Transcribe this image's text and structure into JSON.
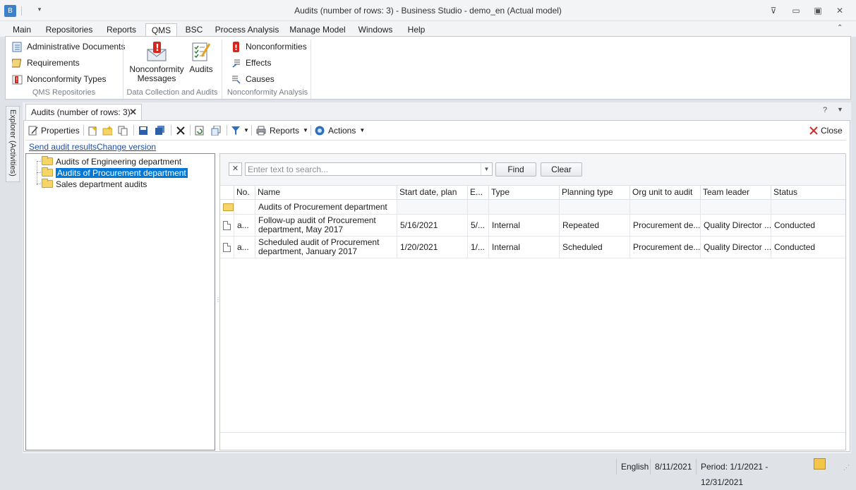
{
  "window": {
    "title": "Audits (number of rows: 3) - Business Studio - demo_en (Actual model)",
    "app_icon_text": "B"
  },
  "ribbon_tabs": [
    "Main",
    "Repositories",
    "Reports",
    "QMS",
    "BSC",
    "Process Analysis",
    "Manage Model",
    "Windows",
    "Help"
  ],
  "ribbon_active_tab": "QMS",
  "ribbon": {
    "qms_repositories": {
      "items": [
        "Administrative Documents",
        "Requirements",
        "Nonconformity Types"
      ],
      "label": "QMS Repositories"
    },
    "data_collection": {
      "nonconformity_messages": "Nonconformity Messages",
      "audits": "Audits",
      "label": "Data Collection and Audits"
    },
    "nonconformity_analysis": {
      "items": [
        "Nonconformities",
        "Effects",
        "Causes"
      ],
      "label": "Nonconformity Analysis"
    }
  },
  "explorer_tab": "Explorer (Activities)",
  "doc_tab": {
    "title": "Audits (number of rows: 3)",
    "close": "✕",
    "help": "?"
  },
  "toolbar": {
    "properties": "Properties",
    "reports": "Reports",
    "actions": "Actions",
    "close": "Close"
  },
  "links": {
    "send_audit_results": "Send audit results",
    "change_version": "Change version"
  },
  "tree": [
    {
      "label": "Audits of Engineering department",
      "selected": false
    },
    {
      "label": "Audits of Procurement department",
      "selected": true
    },
    {
      "label": "Sales department audits",
      "selected": false
    }
  ],
  "search": {
    "placeholder": "Enter text to search...",
    "find": "Find",
    "clear": "Clear"
  },
  "grid": {
    "columns": [
      "No.",
      "Name",
      "Start date, plan",
      "E...",
      "Type",
      "Planning type",
      "Org unit to audit",
      "Team leader",
      "Status"
    ],
    "group_row": "Audits of Procurement department",
    "rows": [
      {
        "no": "a...",
        "name": "Follow-up audit of Procurement department, May 2017",
        "start": "5/16/2021",
        "end": "5/...",
        "type": "Internal",
        "planning": "Repeated",
        "org": "Procurement de...",
        "leader": "Quality Director ...",
        "status": "Conducted"
      },
      {
        "no": "a...",
        "name": "Scheduled audit of Procurement department, January 2017",
        "start": "1/20/2021",
        "end": "1/...",
        "type": "Internal",
        "planning": "Scheduled",
        "org": "Procurement de...",
        "leader": "Quality Director ...",
        "status": "Conducted"
      }
    ]
  },
  "status_bar": {
    "language": "English",
    "date": "8/11/2021",
    "period": "Period: 1/1/2021 - 12/31/2021"
  },
  "colors": {
    "accent": "#0078d7",
    "link": "#1f4eaa",
    "close_red": "#d0312d"
  }
}
